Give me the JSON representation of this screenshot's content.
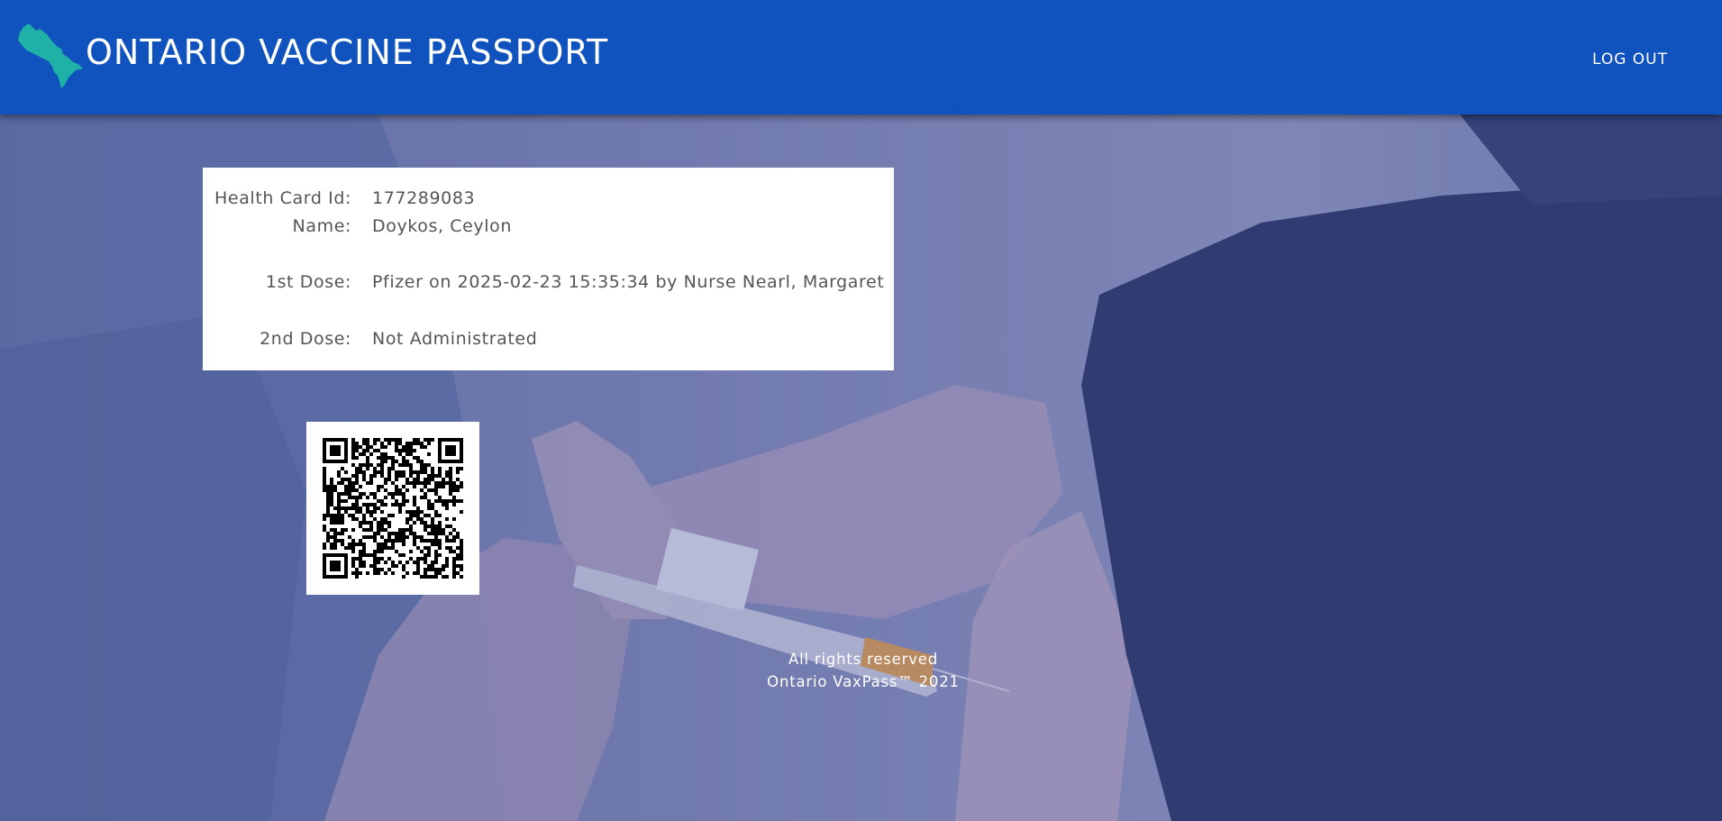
{
  "header": {
    "title": "ONTARIO VACCINE PASSPORT",
    "logout_label": "LOG OUT",
    "logo_icon": "ontario-map-icon",
    "background_color": "#1053bf",
    "logo_color": "#1fb0a8"
  },
  "record": {
    "health_card": {
      "label": "Health Card Id:",
      "value": "177289083"
    },
    "name": {
      "label": "Name:",
      "value": "Doykos, Ceylon"
    },
    "dose1": {
      "label": "1st Dose:",
      "value": "Pfizer on 2025-02-23 15:35:34 by Nurse Nearl, Margaret"
    },
    "dose2": {
      "label": "2nd Dose:",
      "value": "Not Administrated"
    }
  },
  "qr": {
    "icon": "qr-code-icon"
  },
  "footer": {
    "line1": "All rights reserved",
    "line2": "Ontario VaxPass™ 2021"
  }
}
